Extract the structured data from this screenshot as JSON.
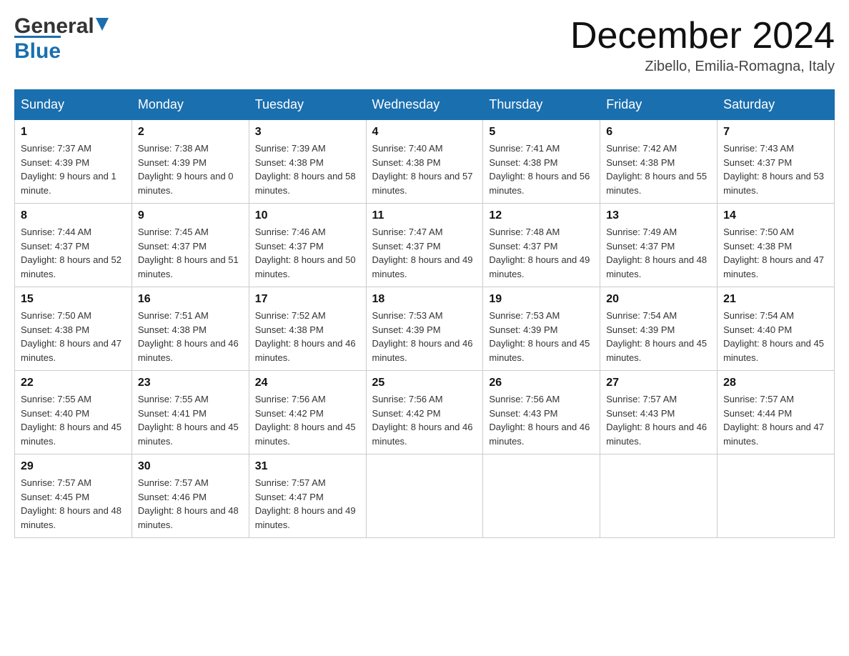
{
  "header": {
    "logo_general": "General",
    "logo_blue": "Blue",
    "calendar_title": "December 2024",
    "calendar_subtitle": "Zibello, Emilia-Romagna, Italy"
  },
  "days_of_week": [
    "Sunday",
    "Monday",
    "Tuesday",
    "Wednesday",
    "Thursday",
    "Friday",
    "Saturday"
  ],
  "weeks": [
    [
      {
        "day": "1",
        "sunrise": "7:37 AM",
        "sunset": "4:39 PM",
        "daylight": "9 hours and 1 minute."
      },
      {
        "day": "2",
        "sunrise": "7:38 AM",
        "sunset": "4:39 PM",
        "daylight": "9 hours and 0 minutes."
      },
      {
        "day": "3",
        "sunrise": "7:39 AM",
        "sunset": "4:38 PM",
        "daylight": "8 hours and 58 minutes."
      },
      {
        "day": "4",
        "sunrise": "7:40 AM",
        "sunset": "4:38 PM",
        "daylight": "8 hours and 57 minutes."
      },
      {
        "day": "5",
        "sunrise": "7:41 AM",
        "sunset": "4:38 PM",
        "daylight": "8 hours and 56 minutes."
      },
      {
        "day": "6",
        "sunrise": "7:42 AM",
        "sunset": "4:38 PM",
        "daylight": "8 hours and 55 minutes."
      },
      {
        "day": "7",
        "sunrise": "7:43 AM",
        "sunset": "4:37 PM",
        "daylight": "8 hours and 53 minutes."
      }
    ],
    [
      {
        "day": "8",
        "sunrise": "7:44 AM",
        "sunset": "4:37 PM",
        "daylight": "8 hours and 52 minutes."
      },
      {
        "day": "9",
        "sunrise": "7:45 AM",
        "sunset": "4:37 PM",
        "daylight": "8 hours and 51 minutes."
      },
      {
        "day": "10",
        "sunrise": "7:46 AM",
        "sunset": "4:37 PM",
        "daylight": "8 hours and 50 minutes."
      },
      {
        "day": "11",
        "sunrise": "7:47 AM",
        "sunset": "4:37 PM",
        "daylight": "8 hours and 49 minutes."
      },
      {
        "day": "12",
        "sunrise": "7:48 AM",
        "sunset": "4:37 PM",
        "daylight": "8 hours and 49 minutes."
      },
      {
        "day": "13",
        "sunrise": "7:49 AM",
        "sunset": "4:37 PM",
        "daylight": "8 hours and 48 minutes."
      },
      {
        "day": "14",
        "sunrise": "7:50 AM",
        "sunset": "4:38 PM",
        "daylight": "8 hours and 47 minutes."
      }
    ],
    [
      {
        "day": "15",
        "sunrise": "7:50 AM",
        "sunset": "4:38 PM",
        "daylight": "8 hours and 47 minutes."
      },
      {
        "day": "16",
        "sunrise": "7:51 AM",
        "sunset": "4:38 PM",
        "daylight": "8 hours and 46 minutes."
      },
      {
        "day": "17",
        "sunrise": "7:52 AM",
        "sunset": "4:38 PM",
        "daylight": "8 hours and 46 minutes."
      },
      {
        "day": "18",
        "sunrise": "7:53 AM",
        "sunset": "4:39 PM",
        "daylight": "8 hours and 46 minutes."
      },
      {
        "day": "19",
        "sunrise": "7:53 AM",
        "sunset": "4:39 PM",
        "daylight": "8 hours and 45 minutes."
      },
      {
        "day": "20",
        "sunrise": "7:54 AM",
        "sunset": "4:39 PM",
        "daylight": "8 hours and 45 minutes."
      },
      {
        "day": "21",
        "sunrise": "7:54 AM",
        "sunset": "4:40 PM",
        "daylight": "8 hours and 45 minutes."
      }
    ],
    [
      {
        "day": "22",
        "sunrise": "7:55 AM",
        "sunset": "4:40 PM",
        "daylight": "8 hours and 45 minutes."
      },
      {
        "day": "23",
        "sunrise": "7:55 AM",
        "sunset": "4:41 PM",
        "daylight": "8 hours and 45 minutes."
      },
      {
        "day": "24",
        "sunrise": "7:56 AM",
        "sunset": "4:42 PM",
        "daylight": "8 hours and 45 minutes."
      },
      {
        "day": "25",
        "sunrise": "7:56 AM",
        "sunset": "4:42 PM",
        "daylight": "8 hours and 46 minutes."
      },
      {
        "day": "26",
        "sunrise": "7:56 AM",
        "sunset": "4:43 PM",
        "daylight": "8 hours and 46 minutes."
      },
      {
        "day": "27",
        "sunrise": "7:57 AM",
        "sunset": "4:43 PM",
        "daylight": "8 hours and 46 minutes."
      },
      {
        "day": "28",
        "sunrise": "7:57 AM",
        "sunset": "4:44 PM",
        "daylight": "8 hours and 47 minutes."
      }
    ],
    [
      {
        "day": "29",
        "sunrise": "7:57 AM",
        "sunset": "4:45 PM",
        "daylight": "8 hours and 48 minutes."
      },
      {
        "day": "30",
        "sunrise": "7:57 AM",
        "sunset": "4:46 PM",
        "daylight": "8 hours and 48 minutes."
      },
      {
        "day": "31",
        "sunrise": "7:57 AM",
        "sunset": "4:47 PM",
        "daylight": "8 hours and 49 minutes."
      },
      null,
      null,
      null,
      null
    ]
  ]
}
